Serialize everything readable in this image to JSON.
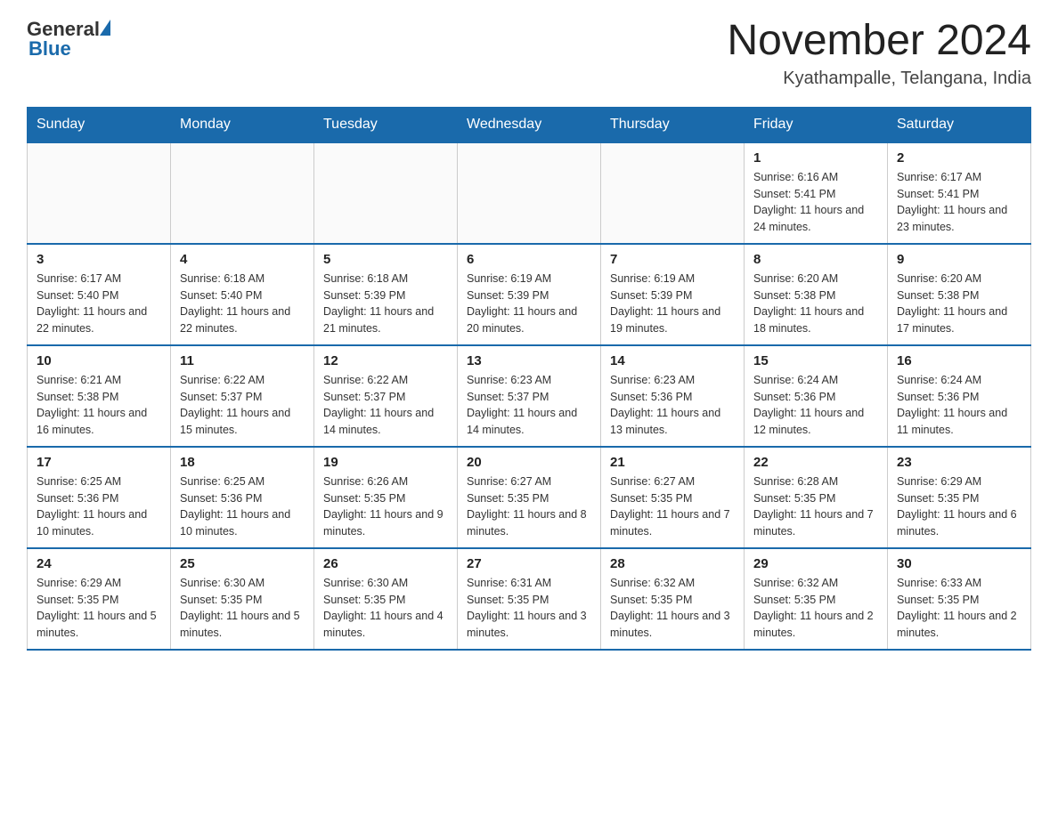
{
  "header": {
    "logo": {
      "general_text": "General",
      "blue_text": "Blue"
    },
    "title": "November 2024",
    "subtitle": "Kyathampalle, Telangana, India"
  },
  "calendar": {
    "days_of_week": [
      "Sunday",
      "Monday",
      "Tuesday",
      "Wednesday",
      "Thursday",
      "Friday",
      "Saturday"
    ],
    "weeks": [
      [
        {
          "day": "",
          "info": ""
        },
        {
          "day": "",
          "info": ""
        },
        {
          "day": "",
          "info": ""
        },
        {
          "day": "",
          "info": ""
        },
        {
          "day": "",
          "info": ""
        },
        {
          "day": "1",
          "info": "Sunrise: 6:16 AM\nSunset: 5:41 PM\nDaylight: 11 hours and 24 minutes."
        },
        {
          "day": "2",
          "info": "Sunrise: 6:17 AM\nSunset: 5:41 PM\nDaylight: 11 hours and 23 minutes."
        }
      ],
      [
        {
          "day": "3",
          "info": "Sunrise: 6:17 AM\nSunset: 5:40 PM\nDaylight: 11 hours and 22 minutes."
        },
        {
          "day": "4",
          "info": "Sunrise: 6:18 AM\nSunset: 5:40 PM\nDaylight: 11 hours and 22 minutes."
        },
        {
          "day": "5",
          "info": "Sunrise: 6:18 AM\nSunset: 5:39 PM\nDaylight: 11 hours and 21 minutes."
        },
        {
          "day": "6",
          "info": "Sunrise: 6:19 AM\nSunset: 5:39 PM\nDaylight: 11 hours and 20 minutes."
        },
        {
          "day": "7",
          "info": "Sunrise: 6:19 AM\nSunset: 5:39 PM\nDaylight: 11 hours and 19 minutes."
        },
        {
          "day": "8",
          "info": "Sunrise: 6:20 AM\nSunset: 5:38 PM\nDaylight: 11 hours and 18 minutes."
        },
        {
          "day": "9",
          "info": "Sunrise: 6:20 AM\nSunset: 5:38 PM\nDaylight: 11 hours and 17 minutes."
        }
      ],
      [
        {
          "day": "10",
          "info": "Sunrise: 6:21 AM\nSunset: 5:38 PM\nDaylight: 11 hours and 16 minutes."
        },
        {
          "day": "11",
          "info": "Sunrise: 6:22 AM\nSunset: 5:37 PM\nDaylight: 11 hours and 15 minutes."
        },
        {
          "day": "12",
          "info": "Sunrise: 6:22 AM\nSunset: 5:37 PM\nDaylight: 11 hours and 14 minutes."
        },
        {
          "day": "13",
          "info": "Sunrise: 6:23 AM\nSunset: 5:37 PM\nDaylight: 11 hours and 14 minutes."
        },
        {
          "day": "14",
          "info": "Sunrise: 6:23 AM\nSunset: 5:36 PM\nDaylight: 11 hours and 13 minutes."
        },
        {
          "day": "15",
          "info": "Sunrise: 6:24 AM\nSunset: 5:36 PM\nDaylight: 11 hours and 12 minutes."
        },
        {
          "day": "16",
          "info": "Sunrise: 6:24 AM\nSunset: 5:36 PM\nDaylight: 11 hours and 11 minutes."
        }
      ],
      [
        {
          "day": "17",
          "info": "Sunrise: 6:25 AM\nSunset: 5:36 PM\nDaylight: 11 hours and 10 minutes."
        },
        {
          "day": "18",
          "info": "Sunrise: 6:25 AM\nSunset: 5:36 PM\nDaylight: 11 hours and 10 minutes."
        },
        {
          "day": "19",
          "info": "Sunrise: 6:26 AM\nSunset: 5:35 PM\nDaylight: 11 hours and 9 minutes."
        },
        {
          "day": "20",
          "info": "Sunrise: 6:27 AM\nSunset: 5:35 PM\nDaylight: 11 hours and 8 minutes."
        },
        {
          "day": "21",
          "info": "Sunrise: 6:27 AM\nSunset: 5:35 PM\nDaylight: 11 hours and 7 minutes."
        },
        {
          "day": "22",
          "info": "Sunrise: 6:28 AM\nSunset: 5:35 PM\nDaylight: 11 hours and 7 minutes."
        },
        {
          "day": "23",
          "info": "Sunrise: 6:29 AM\nSunset: 5:35 PM\nDaylight: 11 hours and 6 minutes."
        }
      ],
      [
        {
          "day": "24",
          "info": "Sunrise: 6:29 AM\nSunset: 5:35 PM\nDaylight: 11 hours and 5 minutes."
        },
        {
          "day": "25",
          "info": "Sunrise: 6:30 AM\nSunset: 5:35 PM\nDaylight: 11 hours and 5 minutes."
        },
        {
          "day": "26",
          "info": "Sunrise: 6:30 AM\nSunset: 5:35 PM\nDaylight: 11 hours and 4 minutes."
        },
        {
          "day": "27",
          "info": "Sunrise: 6:31 AM\nSunset: 5:35 PM\nDaylight: 11 hours and 3 minutes."
        },
        {
          "day": "28",
          "info": "Sunrise: 6:32 AM\nSunset: 5:35 PM\nDaylight: 11 hours and 3 minutes."
        },
        {
          "day": "29",
          "info": "Sunrise: 6:32 AM\nSunset: 5:35 PM\nDaylight: 11 hours and 2 minutes."
        },
        {
          "day": "30",
          "info": "Sunrise: 6:33 AM\nSunset: 5:35 PM\nDaylight: 11 hours and 2 minutes."
        }
      ]
    ]
  }
}
